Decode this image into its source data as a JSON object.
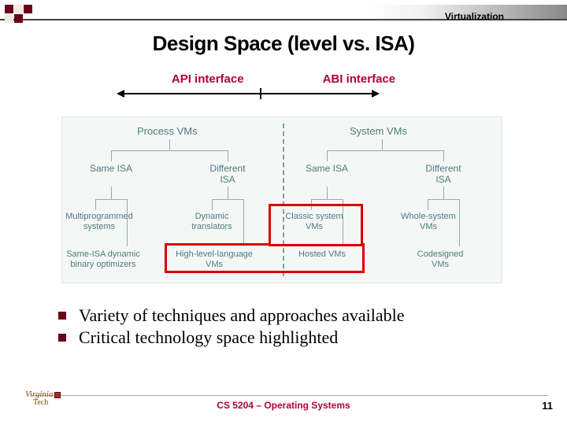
{
  "header": {
    "topic": "Virtualization"
  },
  "title": "Design Space (level vs. ISA)",
  "interfaces": {
    "left": "API interface",
    "right": "ABI interface"
  },
  "diagram": {
    "col_left": "Process VMs",
    "col_right": "System VMs",
    "isa_same_l": "Same\nISA",
    "isa_diff_l": "Different\nISA",
    "isa_same_r": "Same\nISA",
    "isa_diff_r": "Different\nISA",
    "leaf1a": "Multiprogrammed\nsystems",
    "leaf1b": "Same-ISA dynamic\nbinary optimizers",
    "leaf2a": "Dynamic\ntranslators",
    "leaf2b": "High-level-language\nVMs",
    "leaf3a": "Classic system\nVMs",
    "leaf3b": "Hosted\nVMs",
    "leaf4a": "Whole-system\nVMs",
    "leaf4b": "Codesigned\nVMs"
  },
  "bullets": [
    "Variety of techniques and approaches available",
    "Critical technology space highlighted"
  ],
  "footer": {
    "course": "CS 5204 – Operating Systems",
    "page": "11",
    "logo_top": "Virginia",
    "logo_bottom": "Tech"
  }
}
